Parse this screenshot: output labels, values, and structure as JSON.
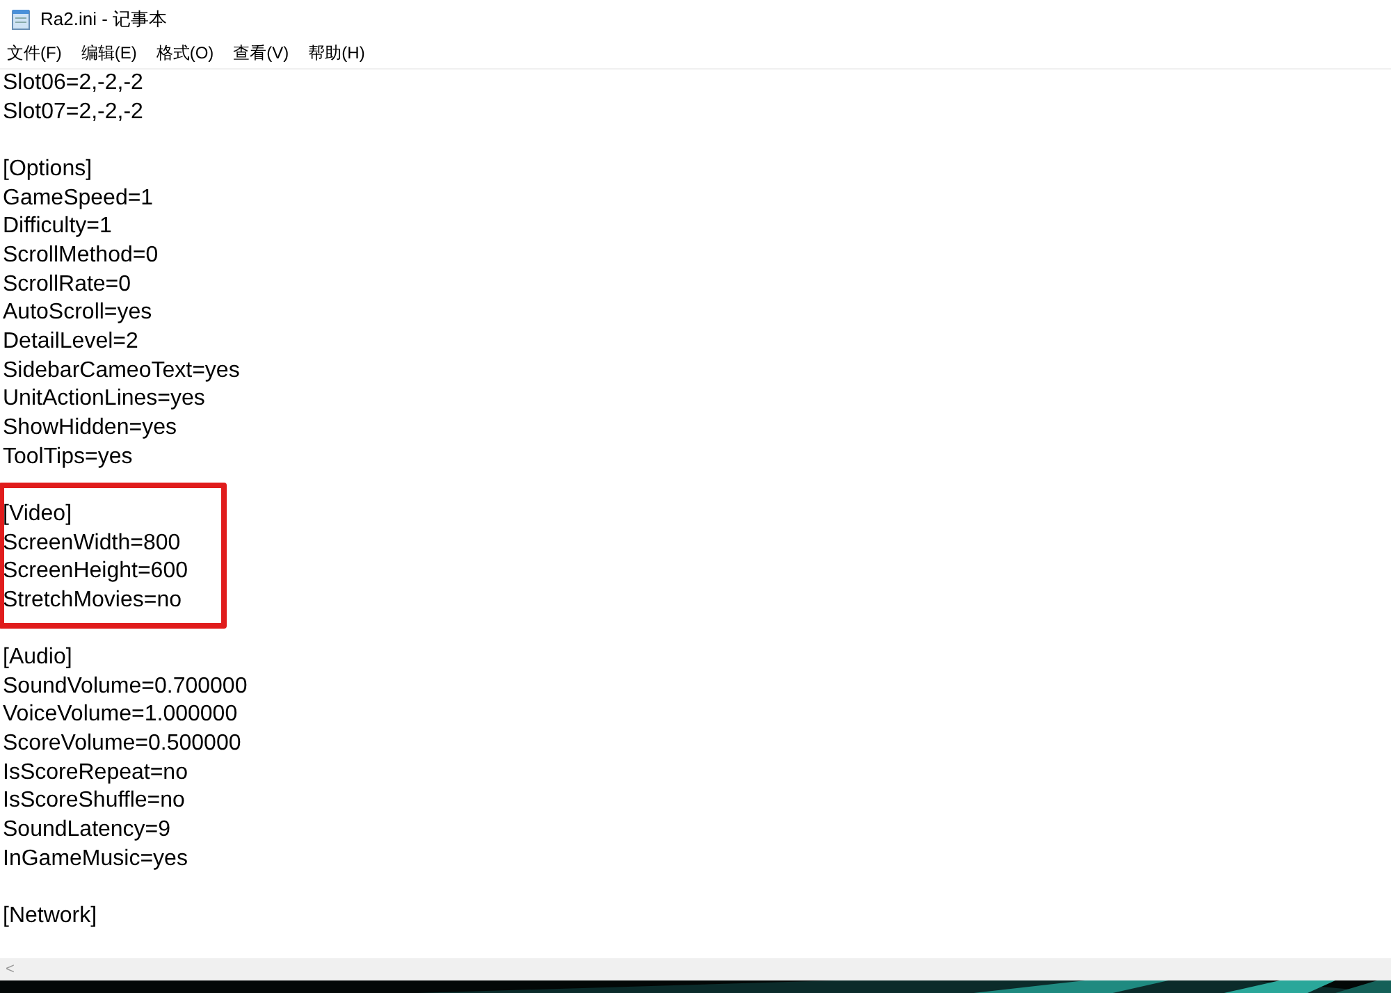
{
  "window": {
    "title": "Ra2.ini - 记事本"
  },
  "menu": [
    "文件(F)",
    "编辑(E)",
    "格式(O)",
    "查看(V)",
    "帮助(H)"
  ],
  "lines": [
    {
      "kind": "text",
      "text": "Slot06=2,-2,-2",
      "highlighted": false
    },
    {
      "kind": "text",
      "text": "Slot07=2,-2,-2",
      "highlighted": false
    },
    {
      "kind": "blank"
    },
    {
      "kind": "text",
      "text": "[Options]",
      "highlighted": false
    },
    {
      "kind": "text",
      "text": "GameSpeed=1",
      "highlighted": false
    },
    {
      "kind": "text",
      "text": "Difficulty=1",
      "highlighted": false
    },
    {
      "kind": "text",
      "text": "ScrollMethod=0",
      "highlighted": false
    },
    {
      "kind": "text",
      "text": "ScrollRate=0",
      "highlighted": false
    },
    {
      "kind": "text",
      "text": "AutoScroll=yes",
      "highlighted": false
    },
    {
      "kind": "text",
      "text": "DetailLevel=2",
      "highlighted": false
    },
    {
      "kind": "text",
      "text": "SidebarCameoText=yes",
      "highlighted": false
    },
    {
      "kind": "text",
      "text": "UnitActionLines=yes",
      "highlighted": false
    },
    {
      "kind": "text",
      "text": "ShowHidden=yes",
      "highlighted": false
    },
    {
      "kind": "text",
      "text": "ToolTips=yes",
      "highlighted": false
    },
    {
      "kind": "blank"
    },
    {
      "kind": "text",
      "text": "[Video]",
      "highlighted": true
    },
    {
      "kind": "text",
      "text": "ScreenWidth=800",
      "highlighted": true
    },
    {
      "kind": "text",
      "text": "ScreenHeight=600",
      "highlighted": true
    },
    {
      "kind": "text",
      "text": "StretchMovies=no",
      "highlighted": true
    },
    {
      "kind": "blank"
    },
    {
      "kind": "text",
      "text": "[Audio]",
      "highlighted": false
    },
    {
      "kind": "text",
      "text": "SoundVolume=0.700000",
      "highlighted": false
    },
    {
      "kind": "text",
      "text": "VoiceVolume=1.000000",
      "highlighted": false
    },
    {
      "kind": "text",
      "text": "ScoreVolume=0.500000",
      "highlighted": false
    },
    {
      "kind": "text",
      "text": "IsScoreRepeat=no",
      "highlighted": false
    },
    {
      "kind": "text",
      "text": "IsScoreShuffle=no",
      "highlighted": false
    },
    {
      "kind": "text",
      "text": "SoundLatency=9",
      "highlighted": false
    },
    {
      "kind": "text",
      "text": "InGameMusic=yes",
      "highlighted": false
    },
    {
      "kind": "blank"
    },
    {
      "kind": "text",
      "text": "[Network]",
      "highlighted": false
    }
  ],
  "scrollbar": {
    "left_arrow": "<"
  }
}
